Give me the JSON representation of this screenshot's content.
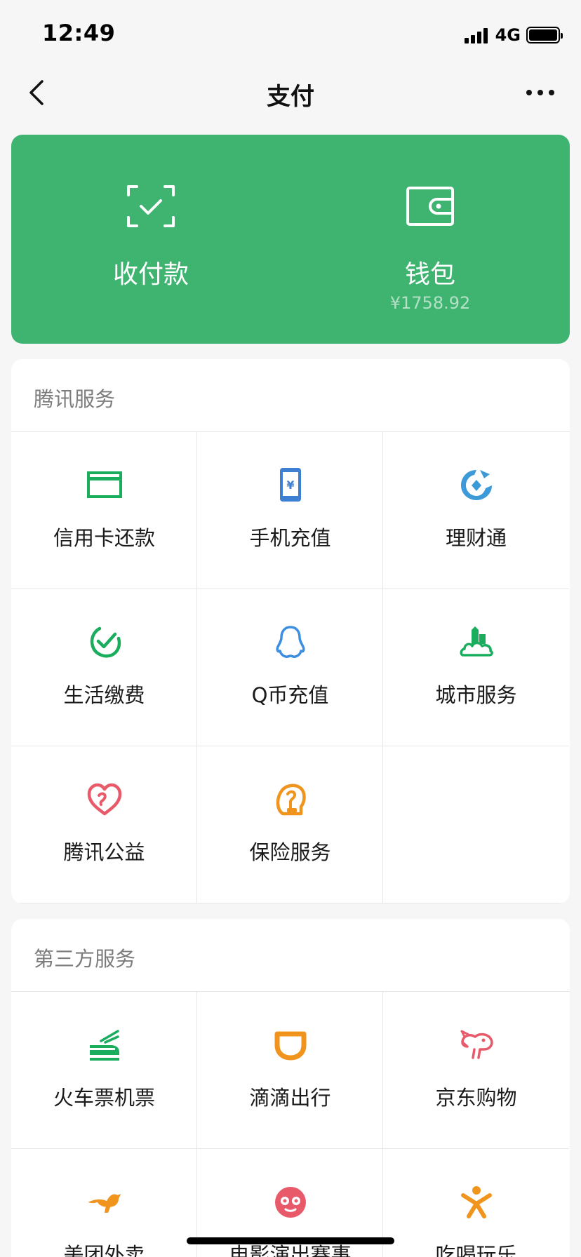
{
  "status": {
    "time": "12:49",
    "network": "4G"
  },
  "nav": {
    "title": "支付"
  },
  "pay_card": {
    "color": "#3fb471",
    "collect": {
      "label": "收付款",
      "icon": "scan-check-icon"
    },
    "wallet": {
      "label": "钱包",
      "balance": "¥1758.92",
      "icon": "wallet-icon"
    }
  },
  "tencent_services": {
    "title": "腾讯服务",
    "items": [
      {
        "label": "信用卡还款",
        "icon": "credit-card-icon",
        "color": "#1aad5d"
      },
      {
        "label": "手机充值",
        "icon": "phone-icon",
        "color": "#3d7fd3"
      },
      {
        "label": "理财通",
        "icon": "wealth-icon",
        "color": "#3c9ad8"
      },
      {
        "label": "生活缴费",
        "icon": "utility-icon",
        "color": "#1aad5d"
      },
      {
        "label": "Q币充值",
        "icon": "qq-penguin-icon",
        "color": "#3c8fe0"
      },
      {
        "label": "城市服务",
        "icon": "city-icon",
        "color": "#1aad5d"
      },
      {
        "label": "腾讯公益",
        "icon": "charity-heart-icon",
        "color": "#e85a6a"
      },
      {
        "label": "保险服务",
        "icon": "insurance-icon",
        "color": "#f0941d"
      }
    ]
  },
  "third_party_services": {
    "title": "第三方服务",
    "items": [
      {
        "label": "火车票机票",
        "icon": "train-icon",
        "color": "#1aad5d"
      },
      {
        "label": "滴滴出行",
        "icon": "didi-icon",
        "color": "#f0941d"
      },
      {
        "label": "京东购物",
        "icon": "jd-dog-icon",
        "color": "#e85a6a"
      },
      {
        "label": "美团外卖",
        "icon": "kangaroo-icon",
        "color": "#f0941d"
      },
      {
        "label": "电影演出赛事",
        "icon": "cat-eye-icon",
        "color": "#e85a6a"
      },
      {
        "label": "吃喝玩乐",
        "icon": "person-icon",
        "color": "#f0941d"
      }
    ]
  }
}
